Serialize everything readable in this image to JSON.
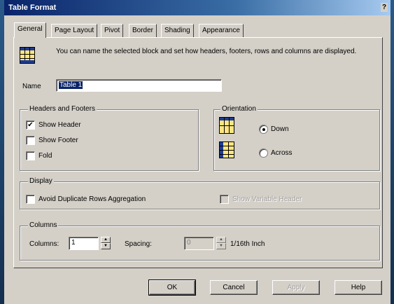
{
  "window": {
    "title": "Table Format",
    "help_glyph": "?"
  },
  "tabs": [
    {
      "label": "General",
      "active": true
    },
    {
      "label": "Page Layout",
      "active": false
    },
    {
      "label": "Pivot",
      "active": false
    },
    {
      "label": "Border",
      "active": false
    },
    {
      "label": "Shading",
      "active": false
    },
    {
      "label": "Appearance",
      "active": false
    }
  ],
  "intro": {
    "icon": "table-icon",
    "text": "You can name the selected block and set how headers, footers, rows and columns are displayed."
  },
  "name_field": {
    "label": "Name",
    "value": "Table 1"
  },
  "headers_footers": {
    "legend": "Headers and Footers",
    "items": [
      {
        "label": "Show Header",
        "checked": true
      },
      {
        "label": "Show Footer",
        "checked": false
      },
      {
        "label": "Fold",
        "checked": false
      }
    ]
  },
  "orientation": {
    "legend": "Orientation",
    "options": [
      {
        "label": "Down",
        "selected": true,
        "icon": "columns-down-icon"
      },
      {
        "label": "Across",
        "selected": false,
        "icon": "rows-across-icon"
      }
    ]
  },
  "display": {
    "legend": "Display",
    "avoid_duplicate": {
      "label": "Avoid Duplicate Rows Aggregation",
      "checked": false
    },
    "show_variable_header": {
      "label": "Show Variable Header",
      "checked": false,
      "disabled": true
    }
  },
  "columns": {
    "legend": "Columns",
    "columns_label": "Columns:",
    "columns_value": "1",
    "spacing_label": "Spacing:",
    "spacing_value": "0",
    "spacing_unit": "1/16th Inch"
  },
  "buttons": {
    "ok": "OK",
    "cancel": "Cancel",
    "apply": "Apply",
    "help": "Help"
  },
  "check_glyph": "✔",
  "spin_up_glyph": "▲",
  "spin_down_glyph": "▼",
  "colors": {
    "title_start": "#0a246a",
    "title_end": "#a6caf0",
    "face": "#d4d0c8",
    "icon_yellow": "#ffe680",
    "icon_blue": "#1e3c96"
  }
}
